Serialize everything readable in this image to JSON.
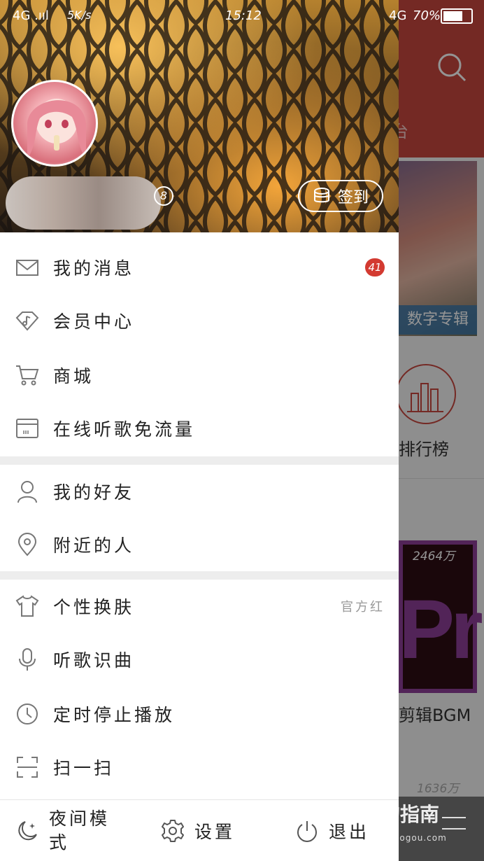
{
  "status_bar": {
    "signal": "4G .ııl",
    "speed": "5K/s",
    "time": "15:12",
    "network": "4G",
    "battery_text": "70%",
    "battery_level": 0.7
  },
  "background": {
    "tab_text": "台",
    "card1_label": "数字专辑",
    "rank_label": "排行榜",
    "card2_count": "2464万",
    "card2_text": "Pr",
    "card2_label": "剪辑BGM",
    "card3_count": "1636万",
    "watermark": "搜狗指南",
    "watermark_sub": "www.sogou.com"
  },
  "header": {
    "level": "8",
    "checkin_label": "签到"
  },
  "menu": {
    "messages": {
      "label": "我的消息",
      "badge": "41"
    },
    "vip": {
      "label": "会员中心"
    },
    "mall": {
      "label": "商城"
    },
    "free_data": {
      "label": "在线听歌免流量"
    },
    "friends": {
      "label": "我的好友"
    },
    "nearby": {
      "label": "附近的人"
    },
    "skin": {
      "label": "个性换肤",
      "value": "官方红"
    },
    "recognize": {
      "label": "听歌识曲"
    },
    "timer": {
      "label": "定时停止播放"
    },
    "scan": {
      "label": "扫一扫"
    }
  },
  "footer": {
    "night_mode": "夜间模式",
    "settings": "设置",
    "exit": "退出"
  },
  "colors": {
    "accent_red": "#c8473f",
    "badge_red": "#d33a31"
  }
}
